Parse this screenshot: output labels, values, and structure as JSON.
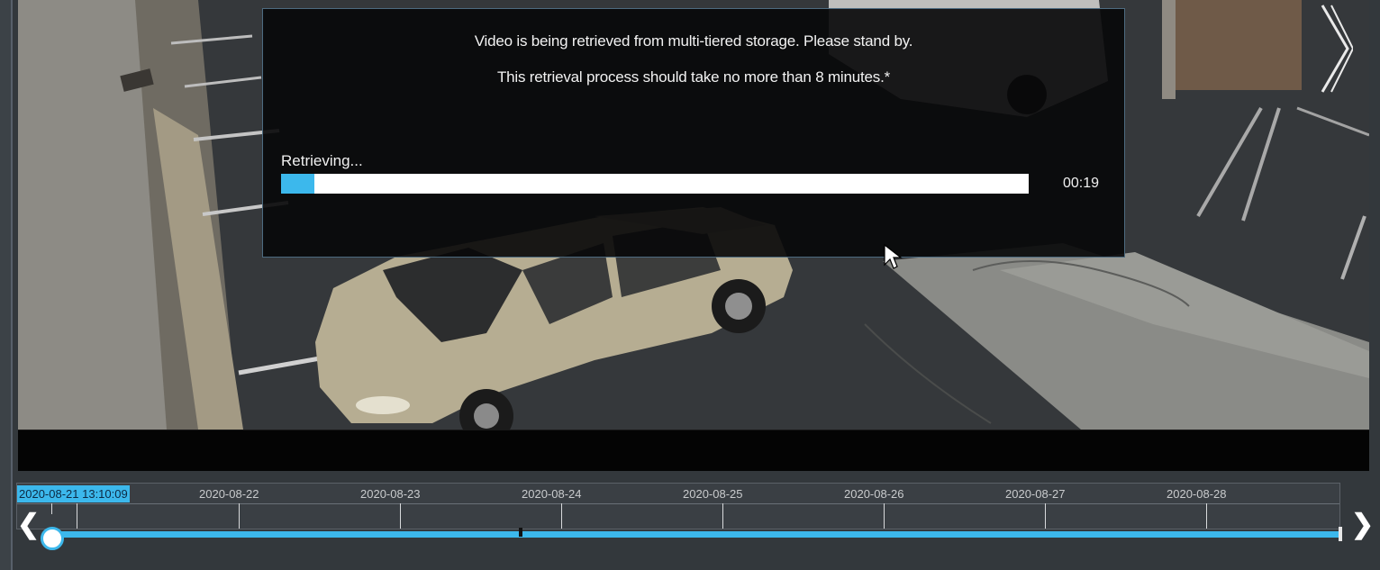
{
  "dialog": {
    "message_line1": "Video is being retrieved from multi-tiered storage. Please stand by.",
    "message_line2": "This retrieval process should take no more than 8 minutes.*",
    "status_label": "Retrieving...",
    "elapsed_time": "00:19",
    "progress_fraction": 0.045
  },
  "timeline": {
    "current_position": "2020-08-21 13:10:09",
    "dates": [
      "2020-08-22",
      "2020-08-23",
      "2020-08-24",
      "2020-08-25",
      "2020-08-26",
      "2020-08-27",
      "2020-08-28"
    ]
  },
  "navigation": {
    "prev_icon": "chevron-left-icon",
    "next_icon": "chevron-right-icon",
    "prev_glyph": "❮",
    "next_glyph": "❯"
  },
  "colors": {
    "accent": "#3cb8ec",
    "dialog_bg": "#080809",
    "progress_track": "#ffffff"
  }
}
